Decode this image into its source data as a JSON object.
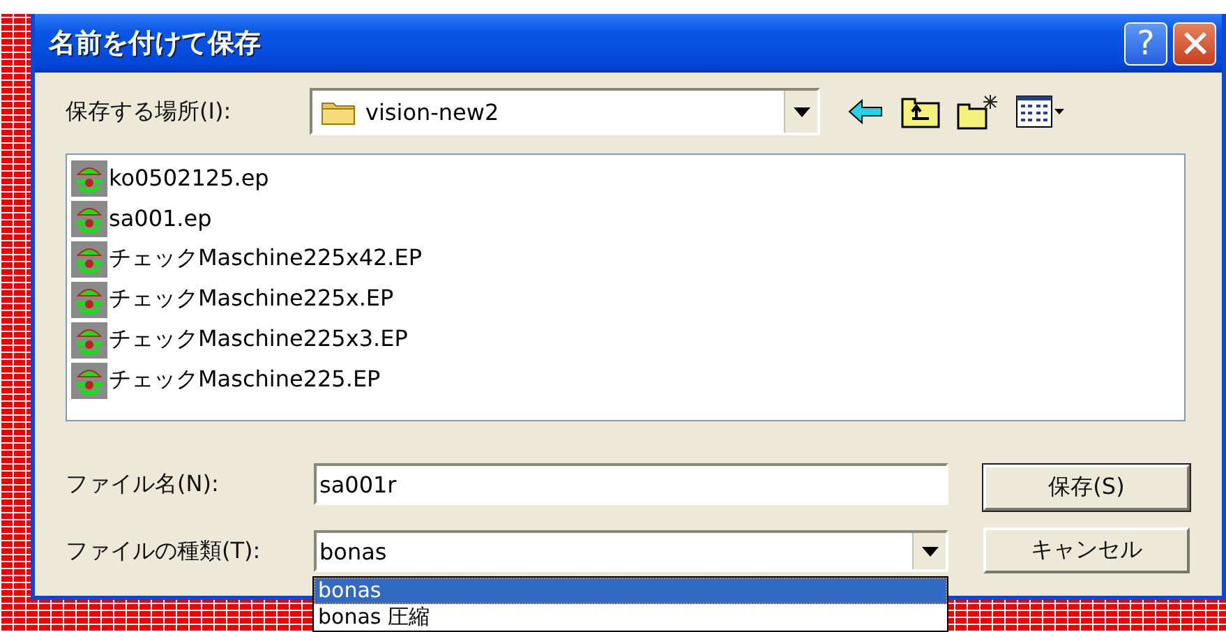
{
  "window": {
    "title": "名前を付けて保存",
    "help_label": "?"
  },
  "location": {
    "label": "保存する場所(I):",
    "value": "vision-new2"
  },
  "toolbar": [
    {
      "kind": "back"
    },
    {
      "kind": "up"
    },
    {
      "kind": "new_folder"
    },
    {
      "kind": "view"
    }
  ],
  "files": [
    {
      "name": "ko0502125.ep"
    },
    {
      "name": "sa001.ep"
    },
    {
      "name": "チェックMaschine225x42.EP"
    },
    {
      "name": "チェックMaschine225x.EP"
    },
    {
      "name": "チェックMaschine225x3.EP"
    },
    {
      "name": "チェックMaschine225.EP"
    }
  ],
  "filename": {
    "label": "ファイル名(N):",
    "value": "sa001r"
  },
  "filetype": {
    "label": "ファイルの種類(T):",
    "value": "bonas",
    "options": [
      {
        "label": "bonas",
        "selected": true
      },
      {
        "label": "bonas 圧縮",
        "selected": false
      }
    ]
  },
  "buttons": [
    {
      "label": "保存(S)",
      "default": true
    },
    {
      "label": "キャンセル",
      "default": false
    }
  ]
}
